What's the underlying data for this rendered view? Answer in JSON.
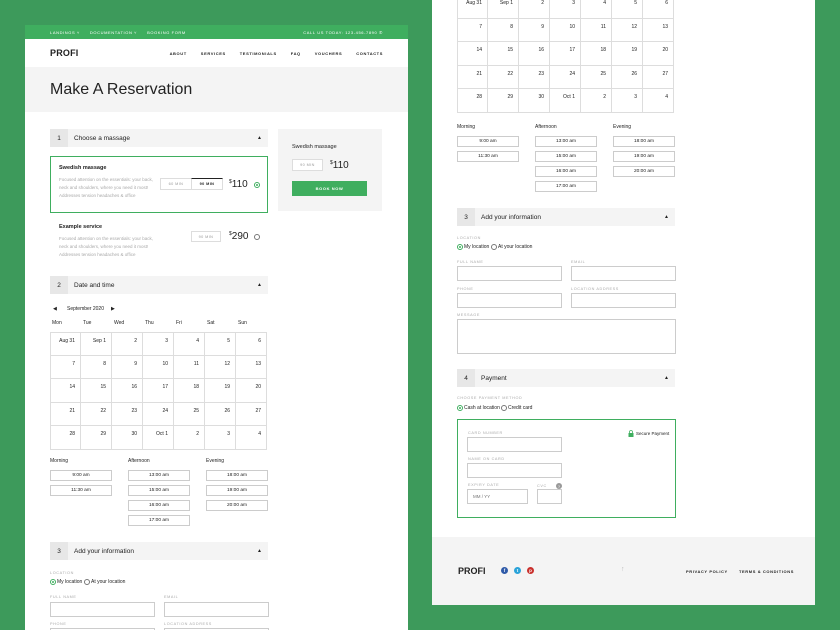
{
  "topbar": {
    "landings": "LANDINGS ˅",
    "documentation": "DOCUMENTATION ˅",
    "booking": "BOOKING FORM",
    "call": "CALL US TODAY: 123-456-7890 ✆"
  },
  "brand": "PROFI",
  "menu": [
    "ABOUT",
    "SERVICES",
    "TESTIMONIALS",
    "FAQ",
    "VOUCHERS",
    "CONTACTS"
  ],
  "page_title": "Make A Reservation",
  "sections": {
    "s1": {
      "num": "1",
      "label": "Choose a massage"
    },
    "s2": {
      "num": "2",
      "label": "Date and time"
    },
    "s3": {
      "num": "3",
      "label": "Add your information"
    },
    "s4": {
      "num": "4",
      "label": "Payment"
    }
  },
  "massages": [
    {
      "title": "Swedish massage",
      "desc": "Focused attention on the essentials: your back, neck and shoulders, where you need it most! Addresses tension headaches & office",
      "opt1": "60 MIN",
      "opt2": "90 MIN",
      "currency": "$",
      "price": "110"
    },
    {
      "title": "Example service",
      "desc": "Focused attention on the essentials: your back, neck and shoulders, where you need it most! Addresses tension headaches & office",
      "opt1": "90 MIN",
      "currency": "$",
      "price": "290"
    }
  ],
  "summary": {
    "title": "Swedish massage",
    "duration": "90 MIN",
    "currency": "$",
    "price": "110",
    "button": "BOOK NOW"
  },
  "calendar": {
    "month": "September 2020",
    "prev": "◀",
    "next": "▶",
    "weekdays": [
      "Mon",
      "Tue",
      "Wed",
      "Thu",
      "Fri",
      "Sat",
      "Sun"
    ],
    "days": [
      "Aug 31",
      "Sep 1",
      "2",
      "3",
      "4",
      "5",
      "6",
      "7",
      "8",
      "9",
      "10",
      "11",
      "12",
      "13",
      "14",
      "15",
      "16",
      "17",
      "18",
      "19",
      "20",
      "21",
      "22",
      "23",
      "24",
      "25",
      "26",
      "27",
      "28",
      "29",
      "30",
      "Oct 1",
      "2",
      "3",
      "4"
    ]
  },
  "timeslots": {
    "morning": {
      "label": "Morning",
      "slots": [
        "9:00 am",
        "11:30 am"
      ]
    },
    "afternoon": {
      "label": "Afternoon",
      "slots": [
        "13:00 am",
        "15:00 am",
        "16:00 am",
        "17:00 am"
      ]
    },
    "evening": {
      "label": "Evening",
      "slots": [
        "18:00 am",
        "19:00 am",
        "20:00 am"
      ]
    }
  },
  "info": {
    "location_label": "LOCATION",
    "my_location": "My location",
    "at_your_location": "At your location",
    "full_name": "FULL NAME",
    "email": "EMAIL",
    "phone": "PHONE",
    "location_address": "LOCATION ADDRESS",
    "message": "MESSAGE"
  },
  "payment": {
    "method_label": "CHOOSE PAYMENT METHOD",
    "cash": "Cash at location",
    "card": "Credit card",
    "card_number": "CARD NUMBER",
    "name_on_card": "NAME ON CARD",
    "expiry": "EXPIRY DATE",
    "expiry_placeholder": "MM / YY",
    "cvc": "CVC",
    "help": "?",
    "secure": "Secure Payment"
  },
  "footer": {
    "brand": "PROFI",
    "up": "↑",
    "privacy": "PRIVACY POLICY",
    "terms": "TERMS & CONDITIONS"
  },
  "colors": {
    "accent": "#3fae5f",
    "background": "#3d9a5b"
  }
}
